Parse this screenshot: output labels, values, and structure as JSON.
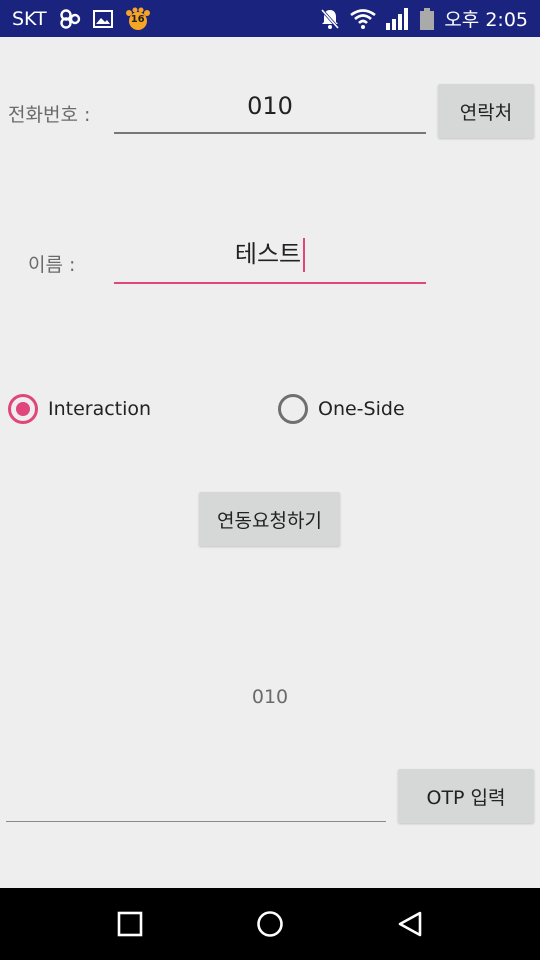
{
  "status_bar": {
    "carrier": "SKT",
    "notification_badge": "16",
    "time": "오후 2:05"
  },
  "form": {
    "phone_label": "전화번호 :",
    "phone_value": "010",
    "contacts_button": "연락처",
    "name_label": "이름 :",
    "name_value": "테스트",
    "mode_options": [
      {
        "label": "Interaction",
        "checked": true
      },
      {
        "label": "One-Side",
        "checked": false
      }
    ],
    "link_request_button": "연동요청하기",
    "otp_display": "010",
    "otp_input_value": "",
    "otp_button": "OTP 입력"
  },
  "colors": {
    "status_bar": "#1a237e",
    "accent": "#e0457b",
    "background": "#eeeeee",
    "button": "#d6d7d7"
  }
}
